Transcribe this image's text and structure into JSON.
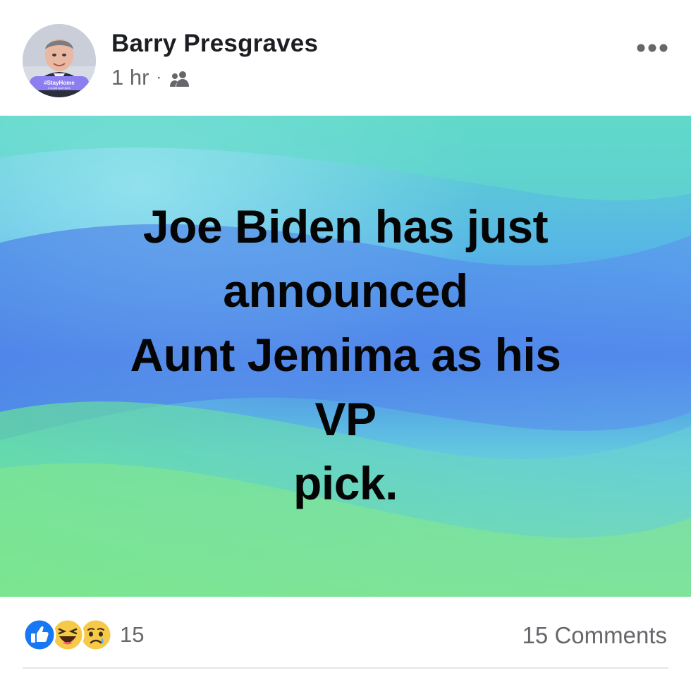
{
  "post": {
    "author": "Barry Presgraves",
    "timestamp": "1 hr",
    "separator": "·",
    "audience_icon": "friends-icon",
    "more_icon": "more-horizontal-icon",
    "avatar_frame_text": "#StayHome",
    "avatar_frame_subtext": "it could save lives"
  },
  "banner": {
    "lines": [
      "Joe Biden has just",
      "announced",
      "Aunt Jemima as his",
      "VP",
      "pick."
    ],
    "colors": {
      "blue": "#4a86e8",
      "teal": "#5fd3c8",
      "green": "#7fe38e",
      "text": "#050505"
    }
  },
  "footer": {
    "reactions": [
      "like-icon",
      "haha-icon",
      "sad-icon"
    ],
    "reaction_count": "15",
    "comments": "15 Comments"
  },
  "colors": {
    "like_blue": "#1877f2",
    "emoji_yellow": "#f7c948",
    "meta_gray": "#65676b"
  }
}
